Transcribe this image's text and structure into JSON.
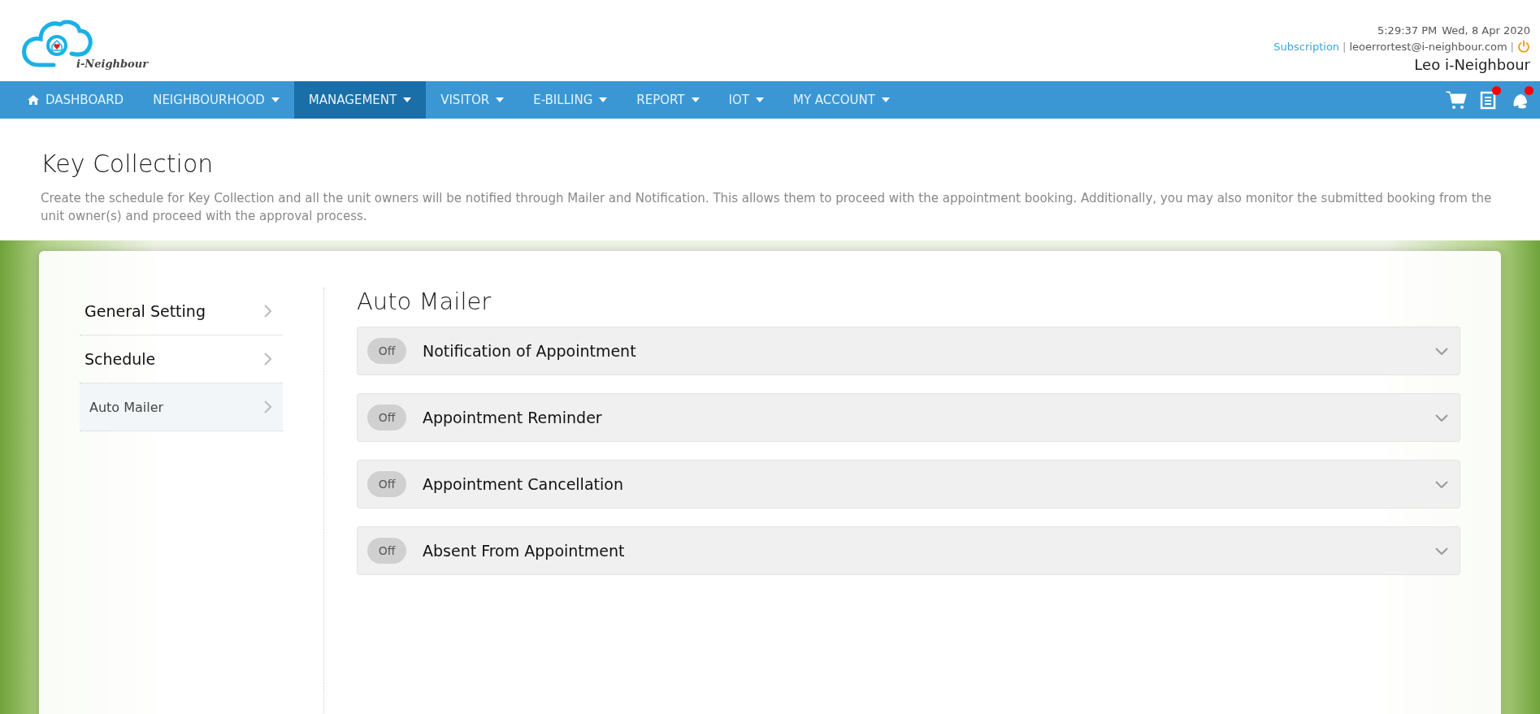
{
  "header": {
    "logo_text": "i-Neighbour",
    "time": "5:29:37 PM",
    "date": "Wed, 8 Apr 2020",
    "subscription_link": "Subscription",
    "separator_1": "|",
    "email": "leoerrortest@i-neighbour.com",
    "separator_2": "|",
    "user_name": "Leo i-Neighbour"
  },
  "nav": {
    "items": [
      {
        "label": "DASHBOARD",
        "selected": false,
        "has_dropdown": false,
        "has_home_icon": true
      },
      {
        "label": "NEIGHBOURHOOD",
        "selected": false,
        "has_dropdown": true,
        "has_home_icon": false
      },
      {
        "label": "MANAGEMENT",
        "selected": true,
        "has_dropdown": true,
        "has_home_icon": false
      },
      {
        "label": "VISITOR",
        "selected": false,
        "has_dropdown": true,
        "has_home_icon": false
      },
      {
        "label": "E-BILLING",
        "selected": false,
        "has_dropdown": true,
        "has_home_icon": false
      },
      {
        "label": "REPORT",
        "selected": false,
        "has_dropdown": true,
        "has_home_icon": false
      },
      {
        "label": "IOT",
        "selected": false,
        "has_dropdown": true,
        "has_home_icon": false
      },
      {
        "label": "MY ACCOUNT",
        "selected": false,
        "has_dropdown": true,
        "has_home_icon": false
      }
    ],
    "icons": [
      {
        "kind": "cart",
        "badge": false
      },
      {
        "kind": "document",
        "badge": true
      },
      {
        "kind": "bell",
        "badge": true
      }
    ]
  },
  "page": {
    "title": "Key Collection",
    "description": "Create the schedule for Key Collection and all the unit owners will be notified through Mailer and Notification. This allows them to proceed with the appointment booking. Additionally, you may also monitor the submitted booking from the unit owner(s) and proceed with the approval process."
  },
  "sidebar": {
    "items": [
      {
        "label": "General Setting",
        "selected": false
      },
      {
        "label": "Schedule",
        "selected": false
      },
      {
        "label": "Auto Mailer",
        "selected": true
      }
    ]
  },
  "content": {
    "title": "Auto Mailer",
    "mailers": [
      {
        "name": "Notification of Appointment",
        "toggle_label": "Off",
        "on": false
      },
      {
        "name": "Appointment Reminder",
        "toggle_label": "Off",
        "on": false
      },
      {
        "name": "Appointment Cancellation",
        "toggle_label": "Off",
        "on": false
      },
      {
        "name": "Absent From Appointment",
        "toggle_label": "Off",
        "on": false
      }
    ]
  }
}
